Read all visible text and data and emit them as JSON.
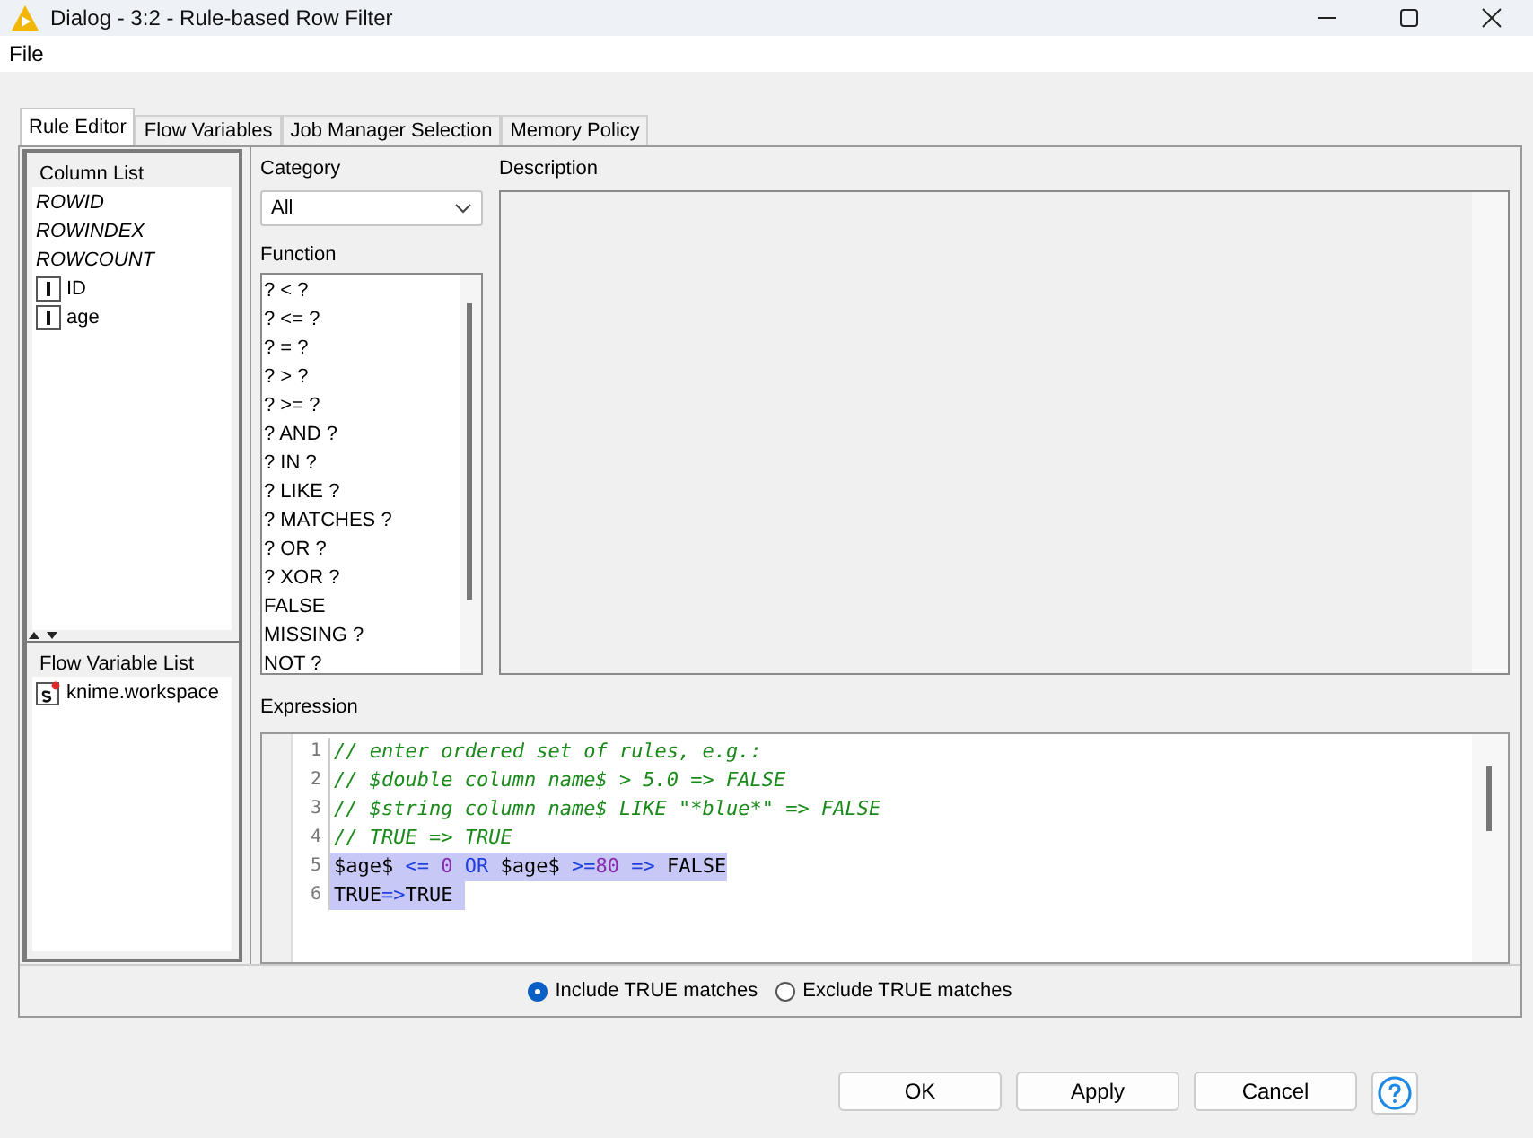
{
  "window": {
    "title": "Dialog - 3:2 - Rule-based Row Filter"
  },
  "menu": [
    "File"
  ],
  "tabs": [
    {
      "label": "Rule Editor",
      "selected": true
    },
    {
      "label": "Flow Variables",
      "selected": false
    },
    {
      "label": "Job Manager Selection",
      "selected": false
    },
    {
      "label": "Memory Policy",
      "selected": false
    }
  ],
  "column_list": {
    "title": "Column List",
    "items": [
      {
        "label": "ROWID",
        "kind": "special"
      },
      {
        "label": "ROWINDEX",
        "kind": "special"
      },
      {
        "label": "ROWCOUNT",
        "kind": "special"
      },
      {
        "label": "ID",
        "kind": "column"
      },
      {
        "label": "age",
        "kind": "column"
      }
    ]
  },
  "flow_variable_list": {
    "title": "Flow Variable List",
    "items": [
      {
        "label": "knime.workspace"
      }
    ]
  },
  "category": {
    "label": "Category",
    "value": "All"
  },
  "function": {
    "label": "Function",
    "items": [
      "? < ?",
      "? <= ?",
      "? = ?",
      "? > ?",
      "? >= ?",
      "? AND ?",
      "? IN ?",
      "? LIKE ?",
      "? MATCHES ?",
      "? OR ?",
      "? XOR ?",
      "FALSE",
      "MISSING ?",
      "NOT ?"
    ]
  },
  "description": {
    "label": "Description"
  },
  "expression": {
    "label": "Expression",
    "lines": [
      {
        "number": "1",
        "selected": false,
        "segments": [
          {
            "kind": "comment",
            "text": "// enter ordered set of rules, e.g.:"
          }
        ]
      },
      {
        "number": "2",
        "selected": false,
        "segments": [
          {
            "kind": "comment",
            "text": "// $double column name$ > 5.0 => FALSE"
          }
        ]
      },
      {
        "number": "3",
        "selected": false,
        "segments": [
          {
            "kind": "comment",
            "text": "// $string column name$ LIKE \"*blue*\" => FALSE"
          }
        ]
      },
      {
        "number": "4",
        "selected": false,
        "segments": [
          {
            "kind": "comment",
            "text": "// TRUE => TRUE"
          }
        ]
      },
      {
        "number": "5",
        "selected": true,
        "segments": [
          {
            "kind": "plain",
            "text": "$age$ "
          },
          {
            "kind": "operator",
            "text": "<= "
          },
          {
            "kind": "number",
            "text": "0 "
          },
          {
            "kind": "operator",
            "text": "OR "
          },
          {
            "kind": "plain",
            "text": "$age$ "
          },
          {
            "kind": "operator",
            "text": ">="
          },
          {
            "kind": "number",
            "text": "80 "
          },
          {
            "kind": "operator",
            "text": "=> "
          },
          {
            "kind": "plain",
            "text": "FALSE"
          }
        ]
      },
      {
        "number": "6",
        "selected": true,
        "segments": [
          {
            "kind": "plain",
            "text": "TRUE"
          },
          {
            "kind": "operator",
            "text": "=>"
          },
          {
            "kind": "plain",
            "text": "TRUE "
          }
        ]
      }
    ]
  },
  "match_options": [
    {
      "label": "Include TRUE matches",
      "selected": true
    },
    {
      "label": "Exclude TRUE matches",
      "selected": false
    }
  ],
  "buttons": [
    "OK",
    "Apply",
    "Cancel"
  ]
}
